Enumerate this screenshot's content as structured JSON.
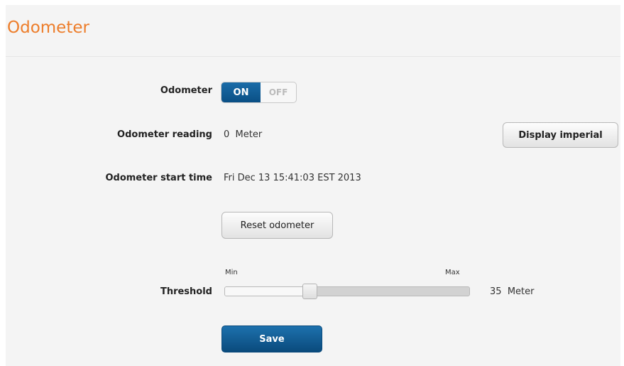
{
  "page": {
    "title": "Odometer"
  },
  "odometer_toggle": {
    "label": "Odometer",
    "on_label": "ON",
    "off_label": "OFF",
    "state": "ON"
  },
  "reading": {
    "label": "Odometer reading",
    "value": "0",
    "unit": "Meter",
    "button": "Display imperial"
  },
  "start_time": {
    "label": "Odometer start time",
    "value": "Fri Dec 13 15:41:03 EST 2013"
  },
  "reset": {
    "button": "Reset odometer"
  },
  "threshold": {
    "label": "Threshold",
    "min_label": "Min",
    "max_label": "Max",
    "value": "35",
    "unit": "Meter",
    "slider_fraction": 0.35
  },
  "save": {
    "button": "Save"
  },
  "colors": {
    "title": "#ed7d2a",
    "accent": "#0a4f85",
    "panel_bg": "#f4f4f4"
  }
}
